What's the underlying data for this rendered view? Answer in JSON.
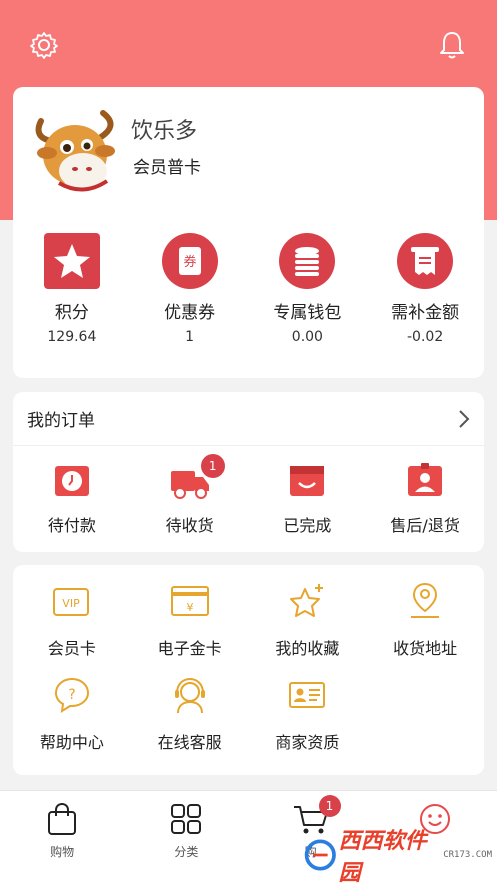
{
  "header": {
    "settings_icon": "gear-icon",
    "notification_icon": "bell-icon"
  },
  "profile": {
    "name": "饮乐多",
    "level": "会员普卡"
  },
  "stats": [
    {
      "label": "积分",
      "value": "129.64",
      "icon": "star-icon"
    },
    {
      "label": "优惠券",
      "value": "1",
      "icon": "coupon-icon",
      "icon_text": "券"
    },
    {
      "label": "专属钱包",
      "value": "0.00",
      "icon": "coins-icon"
    },
    {
      "label": "需补金额",
      "value": "-0.02",
      "icon": "receipt-icon"
    }
  ],
  "orders": {
    "title": "我的订单",
    "items": [
      {
        "label": "待付款",
        "icon": "clock-wallet-icon"
      },
      {
        "label": "待收货",
        "icon": "truck-icon",
        "badge": "1"
      },
      {
        "label": "已完成",
        "icon": "box-done-icon"
      },
      {
        "label": "售后/退货",
        "icon": "person-card-icon"
      }
    ]
  },
  "services": {
    "row1": [
      {
        "label": "会员卡",
        "icon": "vip-card-icon",
        "icon_text": "VIP"
      },
      {
        "label": "电子金卡",
        "icon": "gold-card-icon",
        "icon_text": "¥"
      },
      {
        "label": "我的收藏",
        "icon": "star-plus-icon"
      },
      {
        "label": "收货地址",
        "icon": "location-person-icon"
      }
    ],
    "row2": [
      {
        "label": "帮助中心",
        "icon": "help-icon",
        "icon_text": "?"
      },
      {
        "label": "在线客服",
        "icon": "headset-icon"
      },
      {
        "label": "商家资质",
        "icon": "license-icon"
      }
    ]
  },
  "tabbar": [
    {
      "label": "购物",
      "icon": "shopping-bag-icon"
    },
    {
      "label": "分类",
      "icon": "grid-icon"
    },
    {
      "label": "购",
      "icon": "cart-icon",
      "badge": "1"
    },
    {
      "label": "",
      "icon": "smile-icon"
    }
  ],
  "watermark": {
    "text": "西西软件园",
    "sub": "CR173.COM"
  },
  "colors": {
    "primary": "#f87777",
    "accent": "#d9414a",
    "gold": "#e6a52c"
  }
}
